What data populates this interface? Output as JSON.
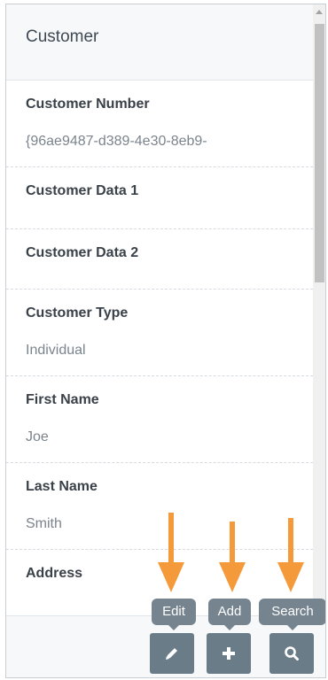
{
  "header": {
    "title": "Customer"
  },
  "fields": [
    {
      "label": "Customer Number",
      "value": "{96ae9487-d389-4e30-8eb9-"
    },
    {
      "label": "Customer Data 1",
      "value": ""
    },
    {
      "label": "Customer Data 2",
      "value": ""
    },
    {
      "label": "Customer Type",
      "value": "Individual"
    },
    {
      "label": "First Name",
      "value": "Joe"
    },
    {
      "label": "Last Name",
      "value": "Smith"
    },
    {
      "label": "Address",
      "value": ""
    }
  ],
  "actions": {
    "edit": {
      "tooltip": "Edit",
      "icon": "pencil-icon"
    },
    "add": {
      "tooltip": "Add",
      "icon": "plus-icon"
    },
    "search": {
      "tooltip": "Search",
      "icon": "magnifier-icon"
    }
  },
  "colors": {
    "action_button": "#6b7c89",
    "tooltip": "#75848f",
    "annotation_arrow": "#f59a3b"
  }
}
